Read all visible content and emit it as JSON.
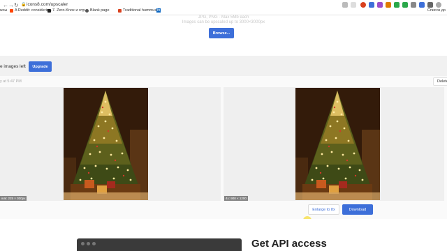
{
  "browser": {
    "url": "icons8.com/upscaler",
    "bookmarks": [
      {
        "label": "жсы",
        "icon": "bookmark-icon",
        "color": "#999999"
      },
      {
        "label": "A Reddit: considerin...",
        "icon": "reddit-icon",
        "color": "#ff4500"
      },
      {
        "label": "7. Zero-Knox и отр...",
        "icon": "site-icon",
        "color": "#222222"
      },
      {
        "label": "Blank page",
        "icon": "globe-icon",
        "color": "#555555"
      },
      {
        "label": "Traditional hummus...",
        "icon": "site-icon",
        "color": "#d9411e"
      },
      {
        "label": "in",
        "icon": "linkedin-icon",
        "color": "#0a66c2"
      }
    ],
    "other_bookmarks": "Список до"
  },
  "upload": {
    "formats_text": "JPG, PNG · Max 5Mb each",
    "limit_text": "Images can be upscaled up to 3000×3000px",
    "browse_label": "Browse..."
  },
  "quota": {
    "text": "e images left",
    "upgrade_label": "Upgrade"
  },
  "result": {
    "timestamp": "y at 5:47 PM",
    "delete_label": "Delete",
    "original_dim": "inal: 225 × 300px",
    "upscaled_dim": "4x: 900 × 1200",
    "enlarge_label": "Enlarge to 8x",
    "download_label": "Download"
  },
  "api": {
    "title": "Get API access"
  },
  "colors": {
    "accent": "#3d6fd9"
  }
}
